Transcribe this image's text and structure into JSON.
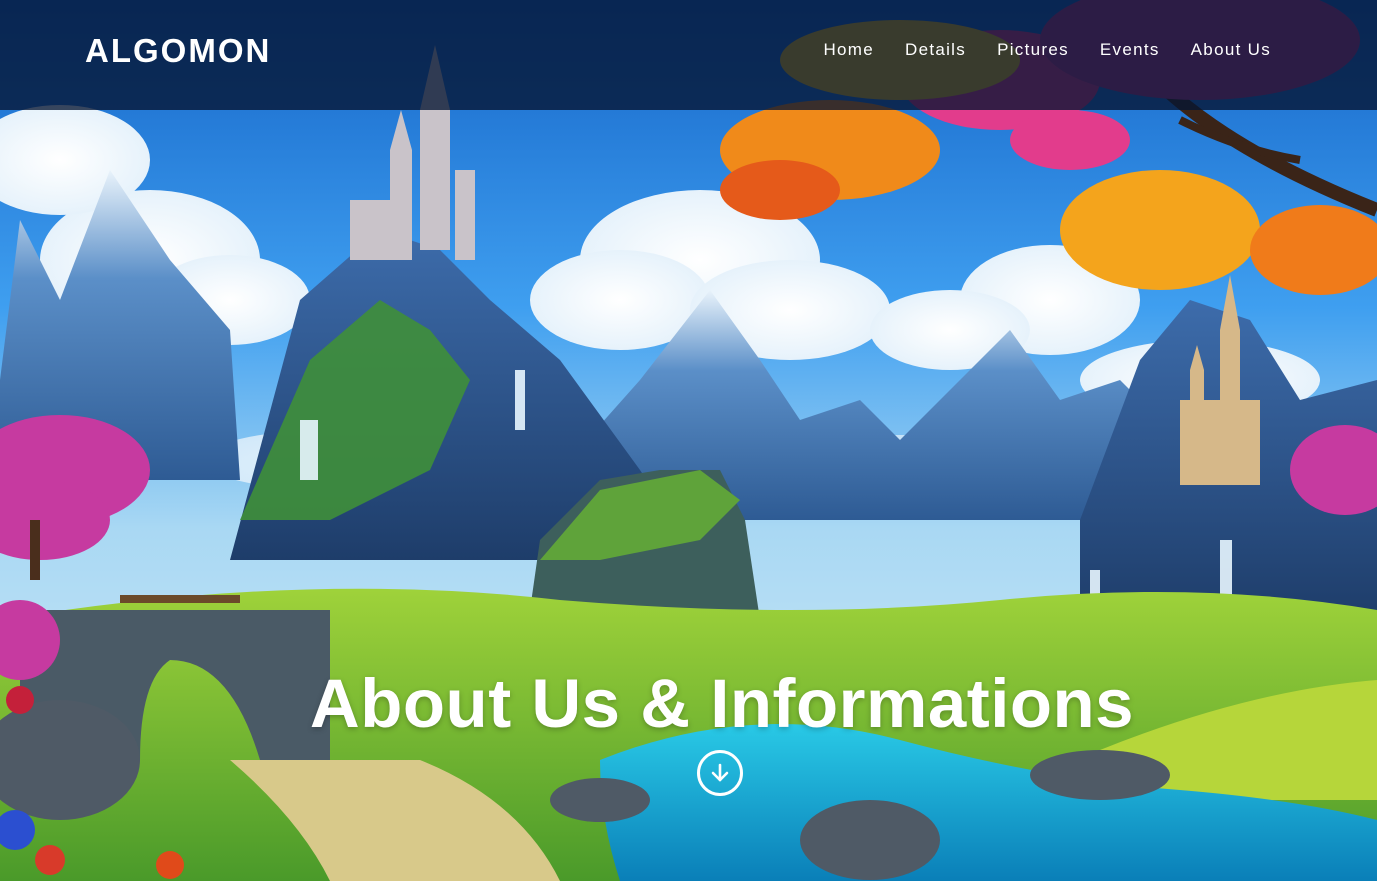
{
  "brand": {
    "name": "ALGOMON"
  },
  "nav": {
    "items": [
      {
        "label": "Home"
      },
      {
        "label": "Details"
      },
      {
        "label": "Pictures"
      },
      {
        "label": "Events"
      },
      {
        "label": "About Us"
      }
    ]
  },
  "hero": {
    "title": "About Us & Informations",
    "scroll_icon": "arrow-down-circle-icon",
    "background": "fantasy-landscape-castles-mountains-lake"
  },
  "colors": {
    "navbar_bg": "#051432",
    "text": "#ffffff"
  }
}
